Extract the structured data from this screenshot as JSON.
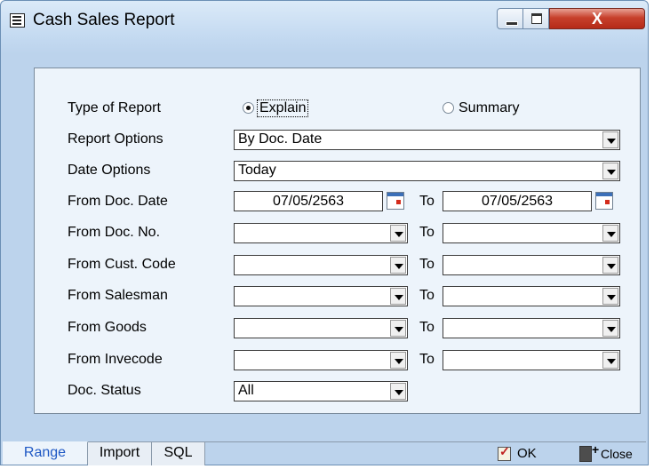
{
  "window": {
    "title": "Cash Sales Report",
    "close_glyph": "X"
  },
  "form": {
    "type_of_report": {
      "label": "Type of Report",
      "options": [
        {
          "label": "Explain",
          "checked": true
        },
        {
          "label": "Summary",
          "checked": false
        }
      ]
    },
    "report_options": {
      "label": "Report Options",
      "value": "By Doc. Date"
    },
    "date_options": {
      "label": "Date Options",
      "value": "Today"
    },
    "from_doc_date": {
      "label": "From Doc. Date",
      "from": "07/05/2563",
      "to_label": "To",
      "to": "07/05/2563"
    },
    "from_doc_no": {
      "label": "From Doc. No.",
      "from": "",
      "to_label": "To",
      "to": ""
    },
    "from_cust_code": {
      "label": "From Cust. Code",
      "from": "",
      "to_label": "To",
      "to": ""
    },
    "from_salesman": {
      "label": "From Salesman",
      "from": "",
      "to_label": "To",
      "to": ""
    },
    "from_goods": {
      "label": "From Goods",
      "from": "",
      "to_label": "To",
      "to": ""
    },
    "from_invecode": {
      "label": "From Invecode",
      "from": "",
      "to_label": "To",
      "to": ""
    },
    "doc_status": {
      "label": "Doc. Status",
      "value": "All"
    }
  },
  "tabs": [
    {
      "label": "Range",
      "active": true
    },
    {
      "label": "Import",
      "active": false
    },
    {
      "label": "SQL",
      "active": false
    }
  ],
  "footer": {
    "ok_label": "OK",
    "close_label": "Close"
  },
  "icons": {
    "title": "report-icon",
    "calendar": "calendar-icon",
    "ok": "ok-icon",
    "close": "exit-door-icon"
  }
}
